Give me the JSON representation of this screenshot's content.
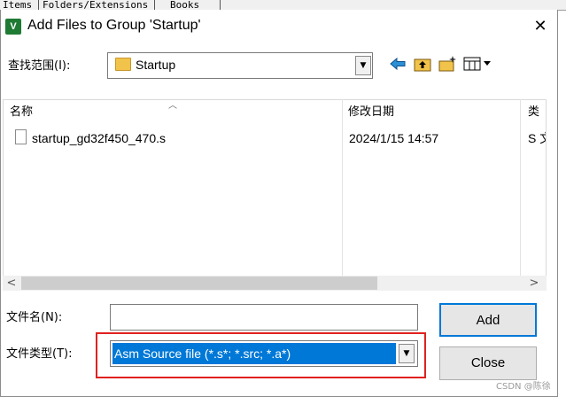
{
  "background_tabs": [
    "Items",
    "Folders/Extensions",
    "Books"
  ],
  "dialog": {
    "title": "Add Files to Group 'Startup'",
    "app_icon": "keil-uvision-icon",
    "close_glyph": "✕"
  },
  "look_in": {
    "label": "查找范围(I):",
    "value": "Startup"
  },
  "toolbar": {
    "back_icon": "back-arrow-icon",
    "up_icon": "up-folder-icon",
    "new_folder_icon": "new-folder-icon",
    "view_icon": "view-menu-icon"
  },
  "file_list": {
    "columns": {
      "name": "名称",
      "date": "修改日期",
      "type": "类"
    },
    "rows": [
      {
        "name": "startup_gd32f450_470.s",
        "date": "2024/1/15 14:57",
        "type": "S 文"
      }
    ]
  },
  "file_name": {
    "label": "文件名(N):",
    "value": ""
  },
  "file_type": {
    "label": "文件类型(T):",
    "value": "Asm Source file (*.s*; *.src; *.a*)"
  },
  "buttons": {
    "add": "Add",
    "close": "Close"
  },
  "colors": {
    "selection": "#0078d7",
    "highlight_box": "#e0211f",
    "folder": "#f2c34a"
  },
  "watermark": "CSDN @陈徐"
}
